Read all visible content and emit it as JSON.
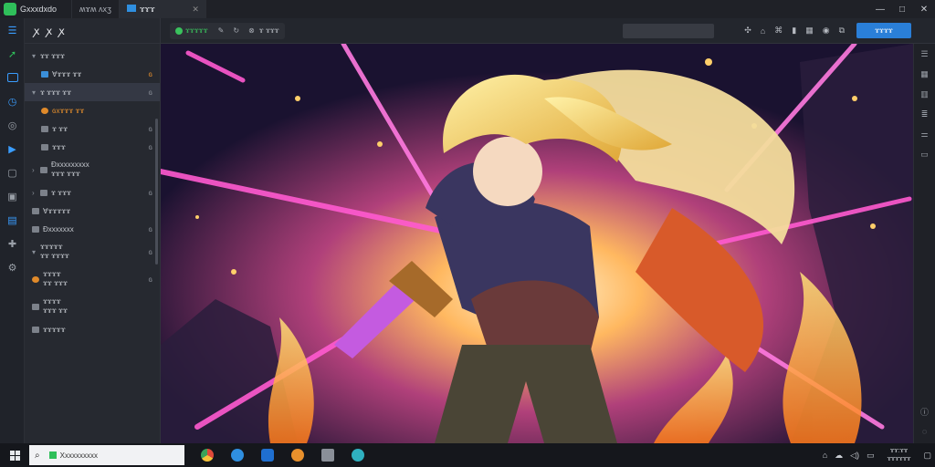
{
  "titlebar": {
    "app_title": "Gxxxdxdo",
    "tab1": "ʍɤʍ ʌxʒ",
    "tab2": "ɤɤɤ",
    "controls": [
      "—",
      "□",
      "✕"
    ]
  },
  "rail": {
    "items": [
      "list-icon",
      "share-icon",
      "image-icon",
      "history-icon",
      "settings-icon",
      "play-icon",
      "square-icon",
      "box-icon",
      "gift-icon",
      "puzzle-icon",
      "gear-icon"
    ]
  },
  "side": {
    "header": "ꭗ ꭗ ꭗ",
    "rows": [
      {
        "label": "ɤɤ ɤɤɤ",
        "badge": "",
        "caret": "▾"
      },
      {
        "label": "Ɐɤɤɤ ɤɤ",
        "badge": "ɢ",
        "caret": ""
      },
      {
        "label": "ɤ ɤɤɤ ɤɤ",
        "badge": "ɢ",
        "caret": "▾"
      },
      {
        "label": "ɢxɤɤɤ ɤɤ",
        "badge": "ɢ",
        "caret": ""
      },
      {
        "label": "ɤ ɤɤ",
        "badge": "ɢ",
        "caret": ""
      },
      {
        "label": "ɤɤɤ",
        "badge": "ɢ",
        "caret": ""
      },
      {
        "label": "Ɖxxxxxxxxx",
        "label2": "ɤɤɤ ɤɤɤ",
        "caret": "›"
      },
      {
        "label": "ɤ ɤɤɤ",
        "badge": "ɢ",
        "caret": "›"
      },
      {
        "label": "Ɐɤɤɤɤɤ",
        "badge": "",
        "caret": ""
      },
      {
        "label": "Ɖxxxxxxx",
        "badge": "ɢ",
        "caret": ""
      },
      {
        "label": "ɤɤɤɤɤ",
        "label2": "ɤɤ ɤɤɤɤ",
        "badge": "ɢ",
        "caret": "▾"
      },
      {
        "label": "ɤɤɤɤ",
        "label2": "ɤɤ ɤɤɤ",
        "badge": "ɢ",
        "caret": ""
      },
      {
        "label": "ɤɤɤɤ",
        "label2": "ɤɤɤ ɤɤ",
        "badge": "",
        "caret": ""
      },
      {
        "label": "ɤɤɤɤɤ",
        "badge": "",
        "caret": ""
      }
    ]
  },
  "toolbar": {
    "run_label": "ɤɤɤɤɤ",
    "mode_label": "ɤ ɤɤɤ",
    "button": "ɤɤɤɤ"
  },
  "taskbar": {
    "search_text": "Xxxxxxxxxx",
    "time": "ɤɤ:ɤɤ",
    "date": "ɤɤɤɤɤɤ"
  }
}
